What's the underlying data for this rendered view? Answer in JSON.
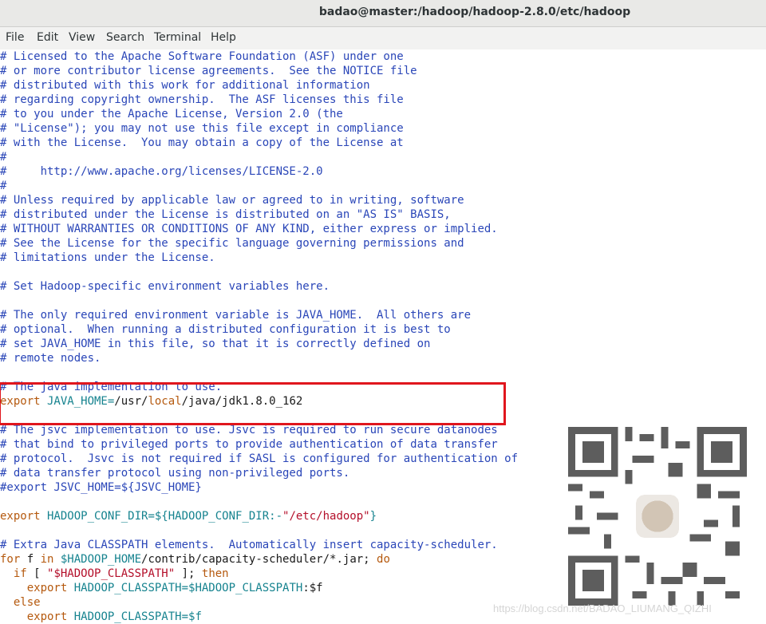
{
  "window": {
    "title": "badao@master:/hadoop/hadoop-2.8.0/etc/hadoop"
  },
  "menu": {
    "file": "File",
    "edit": "Edit",
    "view": "View",
    "search": "Search",
    "terminal": "Terminal",
    "help": "Help"
  },
  "lines": {
    "l0": "# Licensed to the Apache Software Foundation (ASF) under one",
    "l1": "# or more contributor license agreements.  See the NOTICE file",
    "l2": "# distributed with this work for additional information",
    "l3": "# regarding copyright ownership.  The ASF licenses this file",
    "l4": "# to you under the Apache License, Version 2.0 (the",
    "l5": "# \"License\"); you may not use this file except in compliance",
    "l6": "# with the License.  You may obtain a copy of the License at",
    "l7": "#",
    "l8": "#     http://www.apache.org/licenses/LICENSE-2.0",
    "l9": "#",
    "l10": "# Unless required by applicable law or agreed to in writing, software",
    "l11": "# distributed under the License is distributed on an \"AS IS\" BASIS,",
    "l12": "# WITHOUT WARRANTIES OR CONDITIONS OF ANY KIND, either express or implied.",
    "l13": "# See the License for the specific language governing permissions and",
    "l14": "# limitations under the License.",
    "l16": "# Set Hadoop-specific environment variables here.",
    "l18": "# The only required environment variable is JAVA_HOME.  All others are",
    "l19": "# optional.  When running a distributed configuration it is best to",
    "l20": "# set JAVA_HOME in this file, so that it is correctly defined on",
    "l21": "# remote nodes.",
    "l23": "# The java implementation to use.",
    "l24": {
      "k": "export",
      "v": " JAVA_HOME=",
      "t1": "/usr/",
      "k2": "local",
      "t2": "/java/jdk1.8.0_162"
    },
    "l26": "# The jsvc implementation to use. Jsvc is required to run secure datanodes",
    "l27": "# that bind to privileged ports to provide authentication of data transfer",
    "l28": "# protocol.  Jsvc is not required if SASL is configured for authentication of",
    "l29": "# data transfer protocol using non-privileged ports.",
    "l30": "#export JSVC_HOME=${JSVC_HOME}",
    "l32": {
      "k": "export",
      "v": " HADOOP_CONF_DIR=${HADOOP_CONF_DIR:-",
      "s": "\"/etc/hadoop\"",
      "v2": "}"
    },
    "l34": "# Extra Java CLASSPATH elements.  Automatically insert capacity-scheduler.",
    "l35": {
      "k": "for",
      "t1": " f ",
      "k2": "in",
      "v": " $HADOOP_HOME",
      "t2": "/contrib/capacity-scheduler/*.jar; ",
      "k3": "do"
    },
    "l36": {
      "k": "  if",
      "t1": " [ ",
      "s": "\"$HADOOP_CLASSPATH\"",
      "t2": " ]; ",
      "k2": "then"
    },
    "l37": {
      "k": "    export",
      "v": " HADOOP_CLASSPATH=",
      "v2": "$HADOOP_CLASSPATH",
      "t1": ":$f"
    },
    "l38": {
      "k": "  else"
    },
    "l39": {
      "k": "    export",
      "v": " HADOOP_CLASSPATH=",
      "v2": "$f"
    }
  },
  "watermark": "https://blog.csdn.net/BADAO_LIUMANG_QIZHI"
}
